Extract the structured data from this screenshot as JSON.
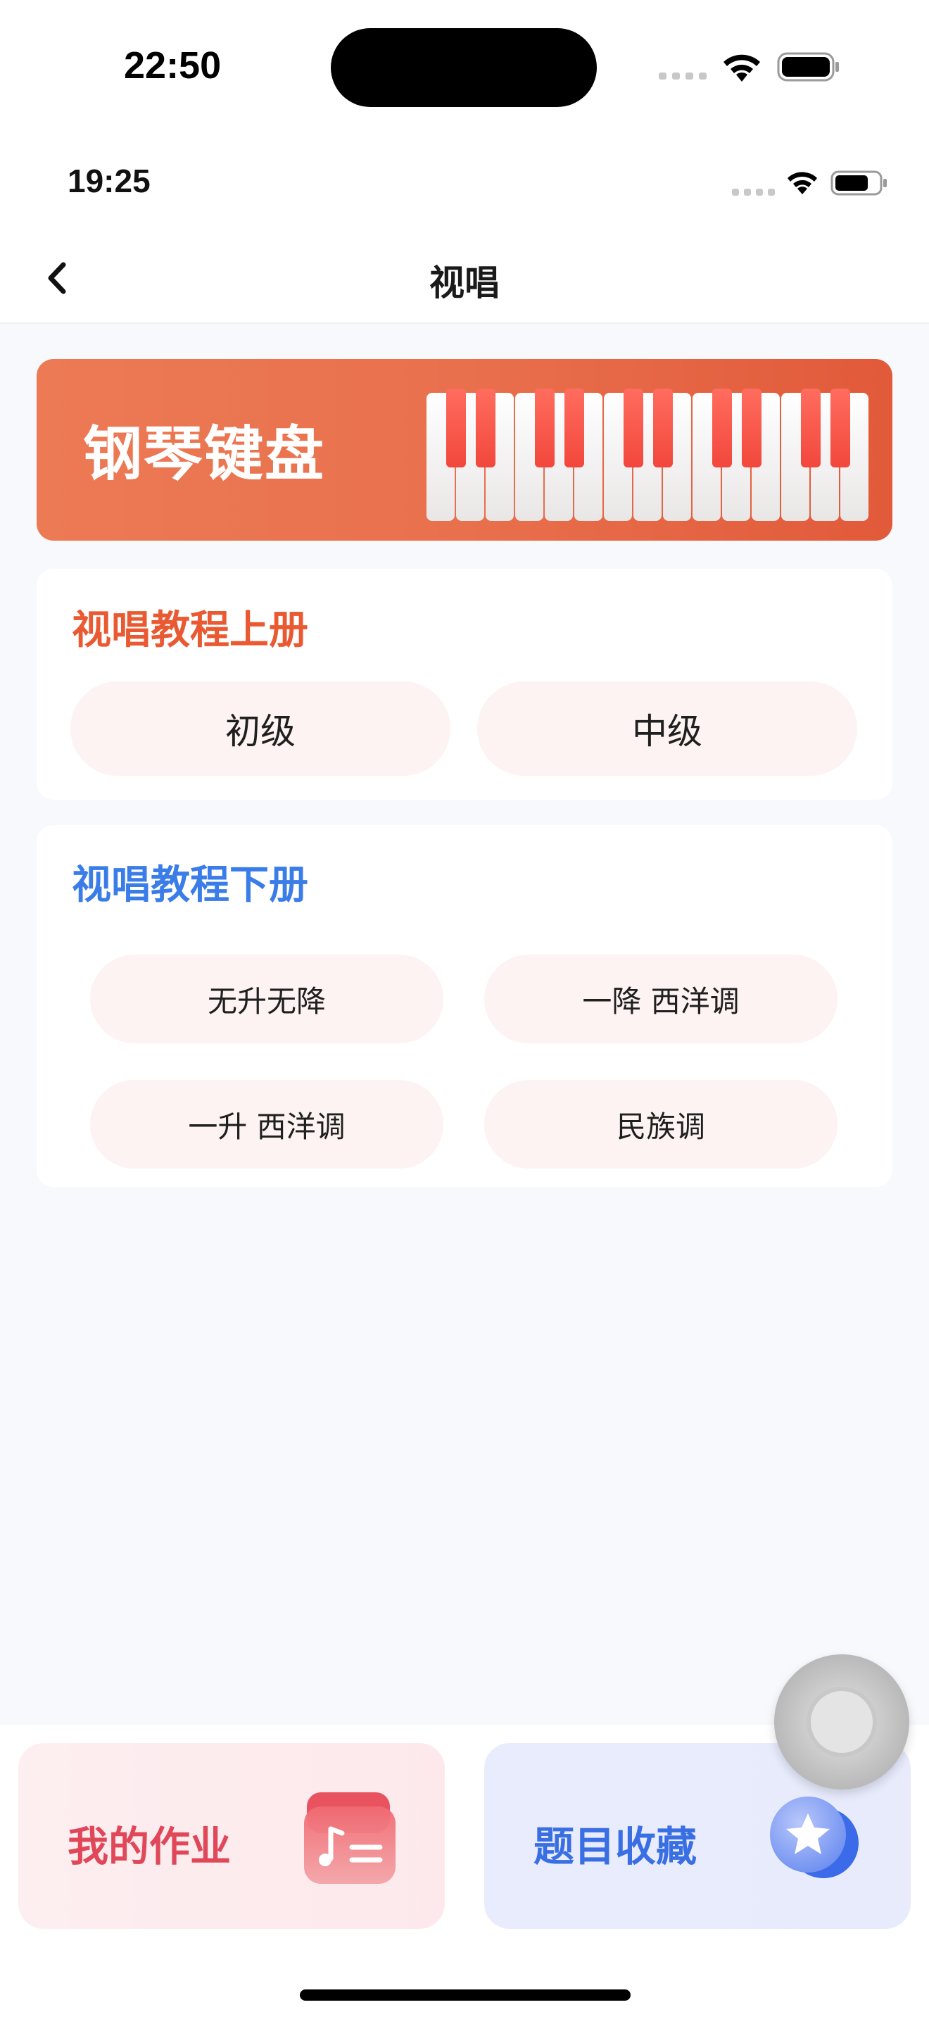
{
  "outer_status": {
    "time": "22:50"
  },
  "inner_status": {
    "time": "19:25"
  },
  "navbar": {
    "title": "视唱",
    "back_icon": "chevron-left-icon"
  },
  "banner": {
    "title": "钢琴键盘",
    "image": "piano-keys-illustration"
  },
  "upper_book": {
    "title": "视唱教程上册",
    "title_color": "#e95a32",
    "levels": [
      "初级",
      "中级"
    ]
  },
  "lower_book": {
    "title": "视唱教程下册",
    "title_color": "#3b7de8",
    "keys": [
      "无升无降",
      "一降 西洋调",
      "一升 西洋调",
      "民族调"
    ]
  },
  "bottom": {
    "homework": {
      "label": "我的作业",
      "icon": "music-note-list-icon",
      "color": "#e0485a"
    },
    "favorites": {
      "label": "题目收藏",
      "icon": "star-icon",
      "color": "#3a6fe4"
    }
  },
  "colors": {
    "accent_orange": "#e95a32",
    "accent_blue": "#3b7de8",
    "pill_bg": "#fdf3f2"
  }
}
